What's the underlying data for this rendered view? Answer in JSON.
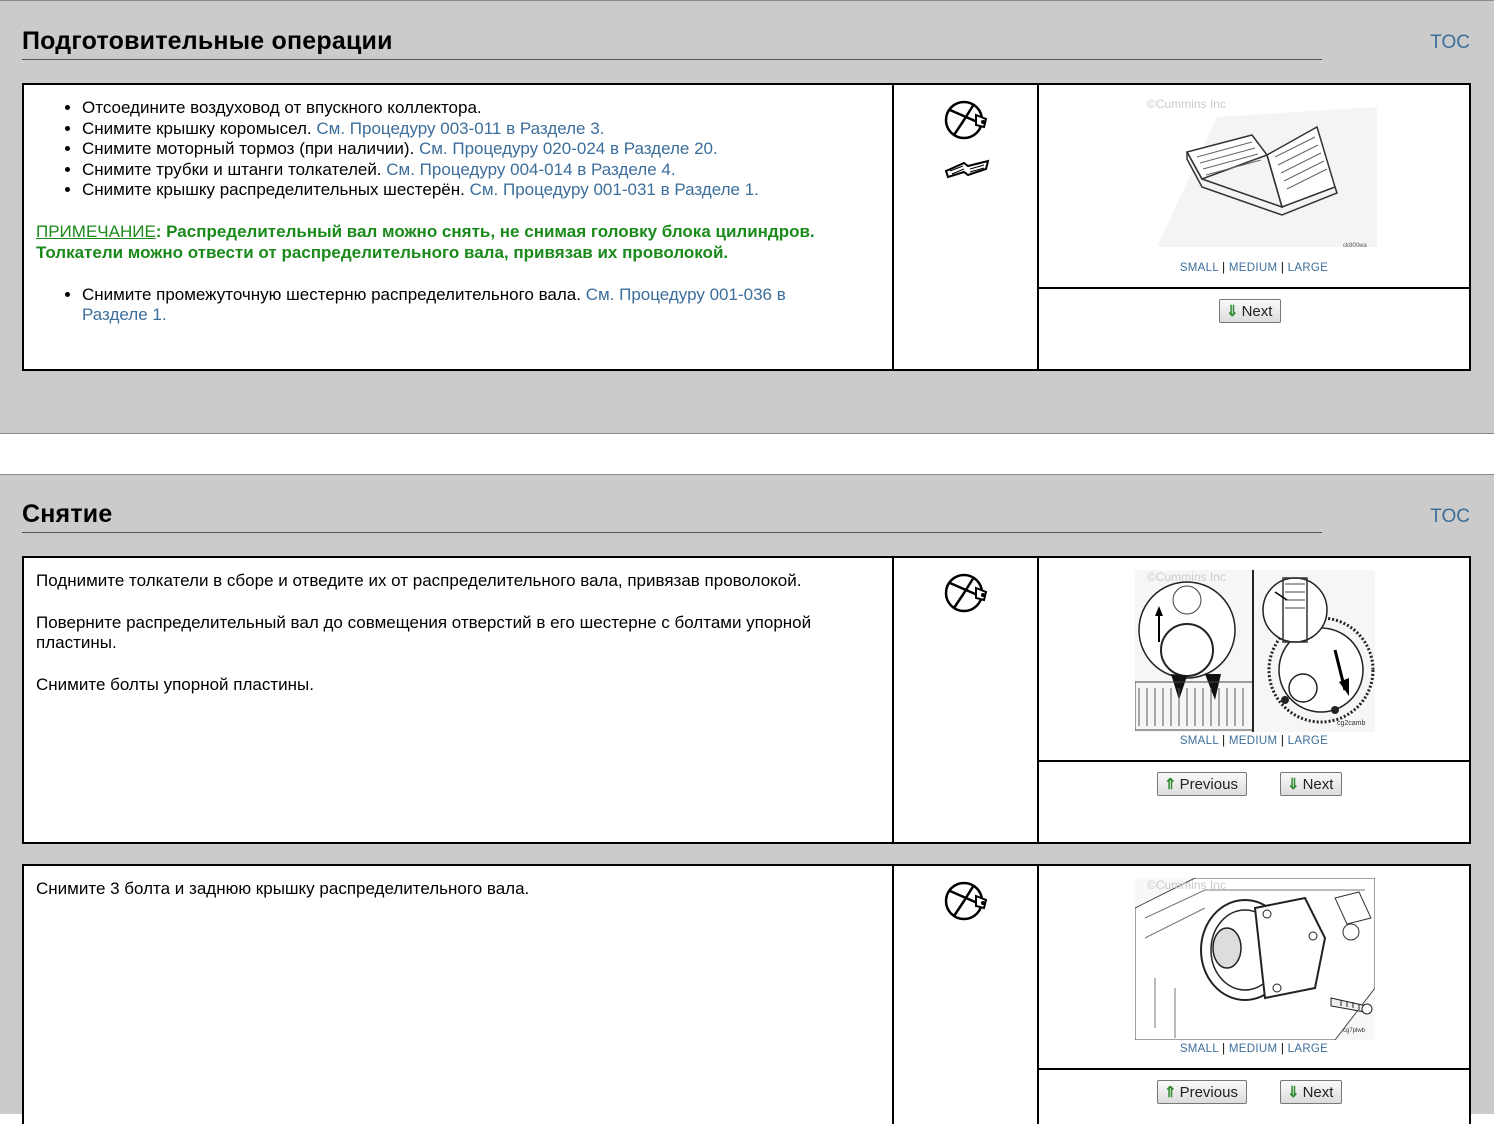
{
  "sections": [
    {
      "title": "Подготовительные операции",
      "toc": "TOC",
      "steps": [
        {
          "bullets": [
            {
              "text": "Отсоедините воздуховод от впускного коллектора.",
              "link": ""
            },
            {
              "text": "Снимите крышку коромысел. ",
              "link": "См. Процедуру 003-011 в Разделе 3."
            },
            {
              "text": "Снимите моторный тормоз (при наличии). ",
              "link": "См. Процедуру 020-024 в Разделе 20."
            },
            {
              "text": "Снимите трубки и штанги толкателей. ",
              "link": "См. Процедуру 004-014 в Разделе 4."
            },
            {
              "text": "Снимите крышку распределительных шестерён. ",
              "link": "См. Процедуру 001-031 в Разделе 1."
            }
          ],
          "note_label": "ПРИМЕЧАНИЕ",
          "note_text": ": Распределительный вал можно снять, не снимая головку блока цилиндров. Толкатели можно отвести от распределительного вала, привязав их проволокой.",
          "bullets2": [
            {
              "text": "Снимите промежуточную шестерню распределительного вала. ",
              "link": "См. Процедуру 001-036 в Разделе 1."
            }
          ],
          "icons": [
            "tool-icon",
            "manual-icon"
          ],
          "figure": {
            "watermark": "©Cummins Inc",
            "code": "ck800wa",
            "sizes": [
              "SMALL",
              "MEDIUM",
              "LARGE"
            ]
          },
          "nav": {
            "next": "Next"
          }
        }
      ]
    },
    {
      "title": "Снятие",
      "toc": "TOC",
      "steps": [
        {
          "paragraphs": [
            "Поднимите толкатели в сборе и отведите их от распределительного вала, привязав проволокой.",
            "Поверните распределительный вал до совмещения отверстий в его шестерне с болтами упорной пластины.",
            "Снимите болты упорной пластины."
          ],
          "icons": [
            "tool-icon"
          ],
          "figure": {
            "watermark": "©Cummins Inc",
            "code": "cg2camb",
            "sizes": [
              "SMALL",
              "MEDIUM",
              "LARGE"
            ]
          },
          "nav": {
            "previous": "Previous",
            "next": "Next"
          }
        },
        {
          "paragraphs": [
            "Снимите 3 болта и заднюю крышку распределительного вала."
          ],
          "icons": [
            "tool-icon"
          ],
          "figure": {
            "watermark": "©Cummins Inc",
            "code": "cg7plwb",
            "sizes": [
              "SMALL",
              "MEDIUM",
              "LARGE"
            ]
          },
          "nav": {
            "previous": "Previous",
            "next": "Next"
          }
        }
      ]
    }
  ],
  "colors": {
    "section_bg": "#cbcbcb",
    "link": "#3c6e9c",
    "note": "#1a8a1a",
    "arrow": "#2f8a2f"
  }
}
